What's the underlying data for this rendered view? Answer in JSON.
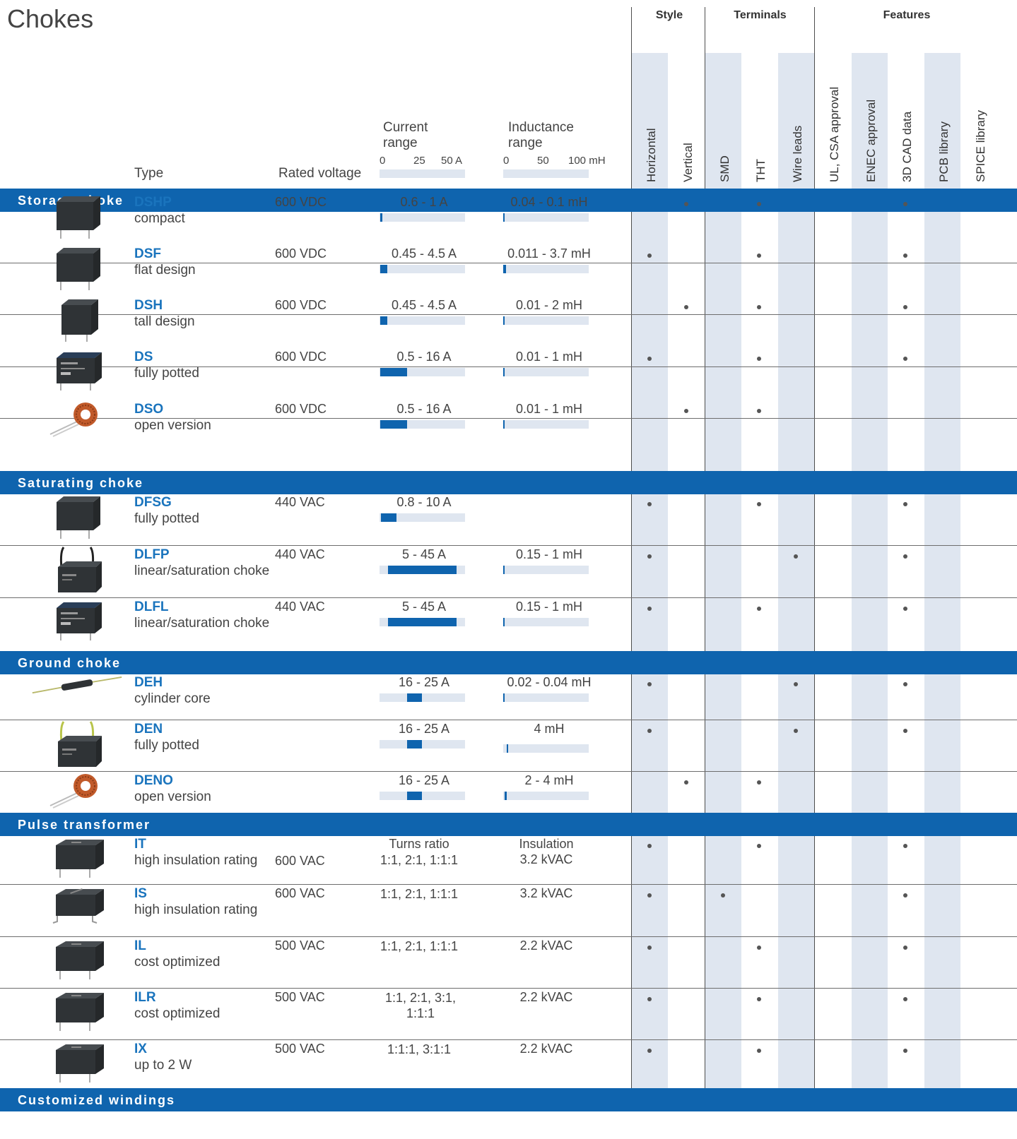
{
  "title": "Chokes",
  "groups": [
    "Style",
    "Terminals",
    "Features"
  ],
  "header": {
    "type": "Type",
    "voltage": "Rated voltage",
    "current": "Current range",
    "current_ticks": [
      "0",
      "25",
      "50 A"
    ],
    "inductance": "Inductance range",
    "inductance_ticks": [
      "0",
      "50",
      "100 mH"
    ]
  },
  "columns": [
    "Horizontal",
    "Vertical",
    "SMD",
    "THT",
    "Wire leads",
    "UL, CSA approval",
    "ENEC approval",
    "3D CAD data",
    "PCB library",
    "SPICE library"
  ],
  "sections": [
    {
      "title": "Storage choke",
      "rows": [
        {
          "code": "DSHP",
          "desc": "compact",
          "voltage": "600 VDC",
          "current": "0.6 - 1 A",
          "cur": [
            0.6,
            1
          ],
          "induct": "0.04 - 0.1 mH",
          "ind": [
            0.04,
            0.1
          ],
          "dots": [
            1,
            3,
            7
          ],
          "img": "choke-block"
        },
        {
          "code": "DSF",
          "desc": "flat design",
          "voltage": "600 VDC",
          "current": "0.45 - 4.5 A",
          "cur": [
            0.45,
            4.5
          ],
          "induct": "0.011 - 3.7 mH",
          "ind": [
            0.011,
            3.7
          ],
          "dots": [
            0,
            3,
            7
          ],
          "img": "choke-block"
        },
        {
          "code": "DSH",
          "desc": "tall design",
          "voltage": "600 VDC",
          "current": "0.45 - 4.5 A",
          "cur": [
            0.45,
            4.5
          ],
          "induct": "0.01 - 2 mH",
          "ind": [
            0.01,
            2
          ],
          "dots": [
            1,
            3,
            7
          ],
          "img": "choke-tall"
        },
        {
          "code": "DS",
          "desc": "fully potted",
          "voltage": "600 VDC",
          "current": "0.5 - 16 A",
          "cur": [
            0.5,
            16
          ],
          "induct": "0.01 - 1 mH",
          "ind": [
            0.01,
            1
          ],
          "dots": [
            0,
            3,
            7
          ],
          "img": "choke-potted"
        },
        {
          "code": "DSO",
          "desc": "open version",
          "voltage": "600 VDC",
          "current": "0.5 - 16 A",
          "cur": [
            0.5,
            16
          ],
          "induct": "0.01 - 1 mH",
          "ind": [
            0.01,
            1
          ],
          "dots": [
            1,
            3
          ],
          "img": "toroid"
        }
      ]
    },
    {
      "title": "Saturating choke",
      "rows": [
        {
          "code": "DFSG",
          "desc": "fully potted",
          "voltage": "440 VAC",
          "current": "0.8 - 10 A",
          "cur": [
            0.8,
            10
          ],
          "induct": "",
          "ind": null,
          "dots": [
            0,
            3,
            7
          ],
          "img": "choke-block"
        },
        {
          "code": "DLFP",
          "desc": "linear/saturation choke",
          "voltage": "440 VAC",
          "current": "5 - 45 A",
          "cur": [
            5,
            45
          ],
          "induct": "0.15 - 1 mH",
          "ind": [
            0.15,
            1
          ],
          "dots": [
            0,
            4,
            7
          ],
          "img": "choke-wires"
        },
        {
          "code": "DLFL",
          "desc": "linear/saturation choke",
          "voltage": "440 VAC",
          "current": "5 - 45 A",
          "cur": [
            5,
            45
          ],
          "induct": "0.15 - 1 mH",
          "ind": [
            0.15,
            1
          ],
          "dots": [
            0,
            3,
            7
          ],
          "img": "choke-potted"
        }
      ]
    },
    {
      "title": "Ground choke",
      "rows": [
        {
          "code": "DEH",
          "desc": "cylinder core",
          "voltage": "",
          "current": "16 - 25 A",
          "cur": [
            16,
            25
          ],
          "induct": "0.02 - 0.04 mH",
          "ind": [
            0.02,
            0.04
          ],
          "dots": [
            0,
            4,
            7
          ],
          "img": "cylinder"
        },
        {
          "code": "DEN",
          "desc": "fully potted",
          "voltage": "",
          "current": "16 - 25 A",
          "cur": [
            16,
            25
          ],
          "induct": "4 mH",
          "ind": [
            4,
            4
          ],
          "dots": [
            0,
            4,
            7
          ],
          "img": "choke-wires-green"
        },
        {
          "code": "DENO",
          "desc": "open version",
          "voltage": "",
          "current": "16 - 25 A",
          "cur": [
            16,
            25
          ],
          "induct": "2 - 4 mH",
          "ind": [
            2,
            4
          ],
          "dots": [
            1,
            3
          ],
          "img": "toroid"
        }
      ]
    },
    {
      "title": "Pulse transformer",
      "rows": [
        {
          "code": "IT",
          "desc": "high insulation rating",
          "voltage": "600 VAC",
          "turns_label": "Turns ratio",
          "turns": "1:1, 2:1, 1:1:1",
          "ins_label": "Insulation",
          "insulation": "3.2 kVAC",
          "dots": [
            0,
            3,
            7
          ],
          "img": "transformer"
        },
        {
          "code": "IS",
          "desc": "high insulation rating",
          "voltage": "600 VAC",
          "turns": "1:1, 2:1, 1:1:1",
          "insulation": "3.2 kVAC",
          "dots": [
            0,
            2,
            7
          ],
          "img": "transformer-smd"
        },
        {
          "code": "IL",
          "desc": "cost optimized",
          "voltage": "500 VAC",
          "turns": "1:1, 2:1, 1:1:1",
          "insulation": "2.2 kVAC",
          "dots": [
            0,
            3,
            7
          ],
          "img": "transformer"
        },
        {
          "code": "ILR",
          "desc": "cost optimized",
          "voltage": "500 VAC",
          "turns": "1:1, 2:1, 3:1, 1:1:1",
          "insulation": "2.2 kVAC",
          "dots": [
            0,
            3,
            7
          ],
          "img": "transformer"
        },
        {
          "code": "IX",
          "desc": "up to 2 W",
          "voltage": "500 VAC",
          "turns": "1:1:1, 3:1:1",
          "insulation": "2.2 kVAC",
          "dots": [
            0,
            3,
            7
          ],
          "img": "transformer"
        }
      ]
    },
    {
      "title": "Customized windings",
      "rows": []
    }
  ]
}
